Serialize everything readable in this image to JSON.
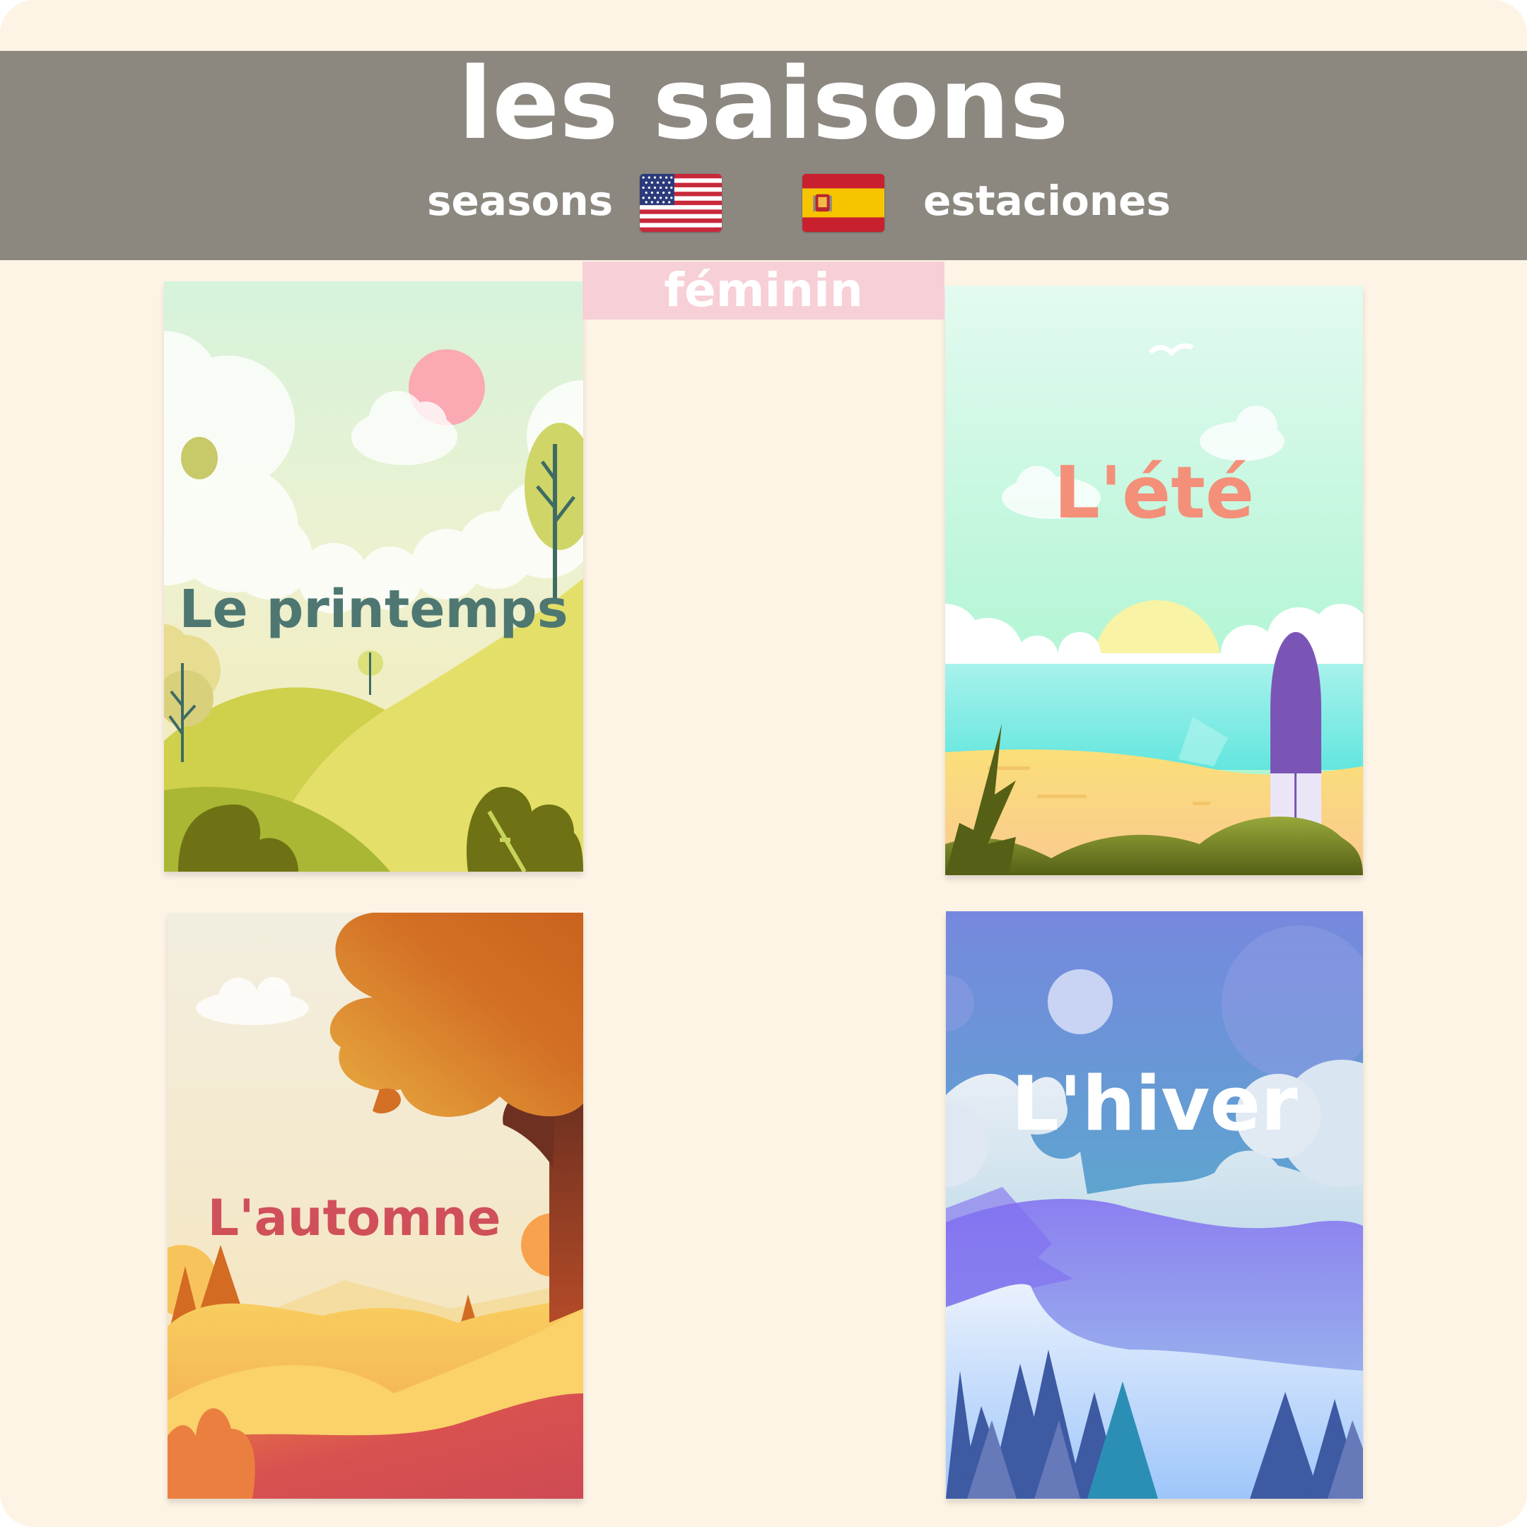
{
  "header": {
    "title": "les saisons",
    "english": "seasons",
    "spanish": "estaciones",
    "gender": "féminin"
  },
  "flags": {
    "english": "us-flag-icon",
    "spanish": "spain-flag-icon"
  },
  "cards": {
    "spring": {
      "label": "Le printemps",
      "label_color": "#4e7772"
    },
    "summer": {
      "label": "L'été",
      "label_color": "#f4907a"
    },
    "autumn": {
      "label": "L'automne",
      "label_color": "#d0505a"
    },
    "winter": {
      "label": "L'hiver",
      "label_color": "#ffffff"
    }
  },
  "colors": {
    "background": "#fdf4e5",
    "header_band": "#8c8880",
    "gender_badge": "#f7cfd6"
  }
}
